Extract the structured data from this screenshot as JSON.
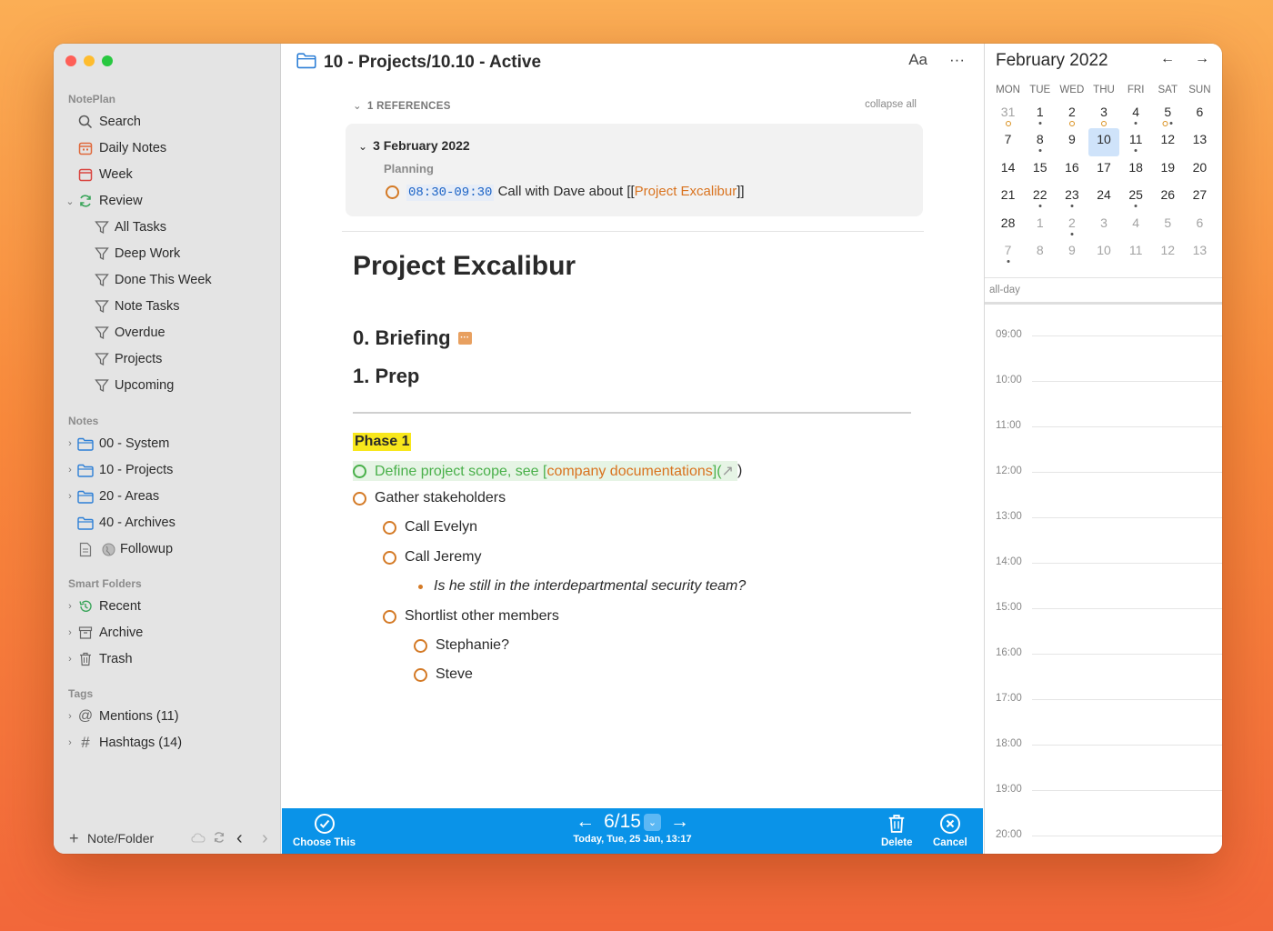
{
  "sidebar": {
    "section_app": "NotePlan",
    "nav": [
      {
        "label": "Search",
        "icon": "search-icon"
      },
      {
        "label": "Daily Notes",
        "icon": "calendar-icon"
      },
      {
        "label": "Week",
        "icon": "calendar-week-icon"
      },
      {
        "label": "Review",
        "icon": "refresh-icon"
      }
    ],
    "filters": [
      "All Tasks",
      "Deep Work",
      "Done This Week",
      "Note Tasks",
      "Overdue",
      "Projects",
      "Upcoming"
    ],
    "section_notes": "Notes",
    "folders": [
      {
        "label": "00 - System",
        "expandable": true
      },
      {
        "label": "10 - Projects",
        "expandable": true
      },
      {
        "label": "20 - Areas",
        "expandable": true
      },
      {
        "label": "40 - Archives",
        "expandable": false
      },
      {
        "label": "Followup",
        "expandable": false
      }
    ],
    "section_smart": "Smart Folders",
    "smart": [
      {
        "label": "Recent",
        "icon": "history-icon"
      },
      {
        "label": "Archive",
        "icon": "archive-icon"
      },
      {
        "label": "Trash",
        "icon": "trash-icon"
      }
    ],
    "section_tags": "Tags",
    "tags": [
      {
        "label": "Mentions (11)",
        "icon": "at-icon"
      },
      {
        "label": "Hashtags (14)",
        "icon": "hash-icon"
      }
    ],
    "new_label": "Note/Folder"
  },
  "editor": {
    "title": "10 - Projects/10.10 - Active",
    "font_button": "Aa",
    "more_button": "···",
    "refs_label": "1 REFERENCES",
    "collapse_all": "collapse all",
    "ref": {
      "date": "3 February 2022",
      "heading": "Planning",
      "time": "08:30-09:30",
      "text_before": "Call with Dave about [[",
      "link": "Project Excalibur",
      "text_after": "]]"
    },
    "h1": "Project Excalibur",
    "h2_briefing": "0. Briefing",
    "h2_prep": "1. Prep",
    "phase": "Phase 1",
    "done_task_before": "Define project scope, see [",
    "done_task_link": "company documentations",
    "done_task_after": "](",
    "done_task_end": ")",
    "tasks": {
      "gather": "Gather stakeholders",
      "evelyn": "Call Evelyn",
      "jeremy": "Call Jeremy",
      "jeremy_note": "Is he still in the interdepartmental security team?",
      "shortlist": "Shortlist other members",
      "stephanie": "Stephanie?",
      "steve": "Steve"
    }
  },
  "bottom_bar": {
    "choose": "Choose This",
    "pager": "6/15",
    "date": "Today, Tue, 25 Jan, 13:17",
    "delete": "Delete",
    "cancel": "Cancel"
  },
  "calendar": {
    "month": "February 2022",
    "weekdays": [
      "MON",
      "TUE",
      "WED",
      "THU",
      "FRI",
      "SAT",
      "SUN"
    ],
    "weeks": [
      [
        [
          "31",
          "dim",
          "ring"
        ],
        [
          "1",
          "",
          "dot"
        ],
        [
          "2",
          "",
          "ring"
        ],
        [
          "3",
          "",
          "ring"
        ],
        [
          "4",
          "",
          "dot"
        ],
        [
          "5",
          "",
          "ringdot"
        ],
        [
          "6",
          "",
          ""
        ]
      ],
      [
        [
          "7",
          "",
          ""
        ],
        [
          "8",
          "",
          "dot"
        ],
        [
          "9",
          "",
          ""
        ],
        [
          "10",
          "today",
          ""
        ],
        [
          "11",
          "",
          "dot"
        ],
        [
          "12",
          "",
          ""
        ],
        [
          "13",
          "",
          ""
        ]
      ],
      [
        [
          "14",
          "",
          ""
        ],
        [
          "15",
          "",
          ""
        ],
        [
          "16",
          "",
          ""
        ],
        [
          "17",
          "",
          ""
        ],
        [
          "18",
          "",
          ""
        ],
        [
          "19",
          "",
          ""
        ],
        [
          "20",
          "",
          ""
        ]
      ],
      [
        [
          "21",
          "",
          ""
        ],
        [
          "22",
          "",
          "dot"
        ],
        [
          "23",
          "",
          "dot"
        ],
        [
          "24",
          "",
          ""
        ],
        [
          "25",
          "",
          "dot"
        ],
        [
          "26",
          "",
          ""
        ],
        [
          "27",
          "",
          ""
        ]
      ],
      [
        [
          "28",
          "",
          ""
        ],
        [
          "1",
          "dim",
          ""
        ],
        [
          "2",
          "dim",
          "dot"
        ],
        [
          "3",
          "dim",
          ""
        ],
        [
          "4",
          "dim",
          ""
        ],
        [
          "5",
          "dim",
          ""
        ],
        [
          "6",
          "dim",
          ""
        ]
      ],
      [
        [
          "7",
          "dim",
          "dot"
        ],
        [
          "8",
          "dim",
          ""
        ],
        [
          "9",
          "dim",
          ""
        ],
        [
          "10",
          "dim",
          ""
        ],
        [
          "11",
          "dim",
          ""
        ],
        [
          "12",
          "dim",
          ""
        ],
        [
          "13",
          "dim",
          ""
        ]
      ]
    ],
    "all_day": "all-day",
    "hours": [
      "09:00",
      "10:00",
      "11:00",
      "12:00",
      "13:00",
      "14:00",
      "15:00",
      "16:00",
      "17:00",
      "18:00",
      "19:00",
      "20:00"
    ]
  },
  "colors": {
    "accent": "#0a93e8",
    "task_orange": "#d47a26",
    "done_green": "#49b04a",
    "highlight": "#f8e71c"
  }
}
